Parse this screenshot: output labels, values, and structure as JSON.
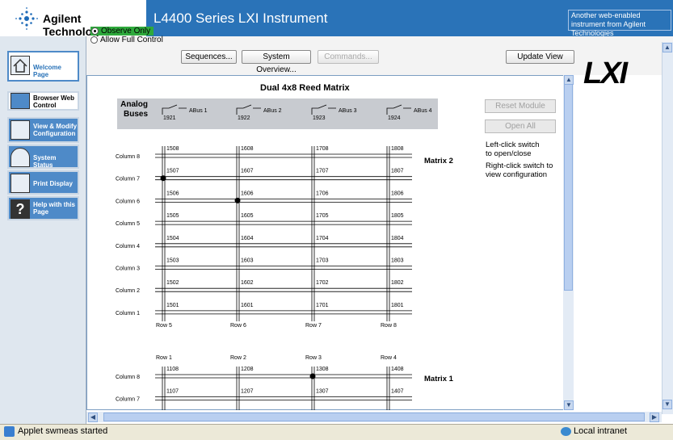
{
  "header": {
    "brand": "Agilent Technologies",
    "title": "L4400 Series LXI Instrument",
    "tagline": "Another web-enabled instrument from Agilent Technologies",
    "lxi_logo": "LXI",
    "brand_color": "#2a73b8"
  },
  "sidebar": {
    "items": [
      {
        "label": "Welcome Page",
        "icon": "home-icon",
        "active": true
      },
      {
        "label": "Browser Web Control",
        "icon": "browser-control-icon",
        "active": false
      },
      {
        "label": "View & Modify Configuration",
        "icon": "configuration-icon",
        "active": false
      },
      {
        "label": "System Status",
        "icon": "status-gauge-icon",
        "active": false
      },
      {
        "label": "Print Display",
        "icon": "printer-icon",
        "active": false
      },
      {
        "label": "Help with this Page",
        "icon": "help-icon",
        "active": false
      }
    ]
  },
  "toolbar": {
    "observe_only": "Observe Only",
    "allow_full": "Allow Full Control",
    "sequences": "Sequences...",
    "system_overview": "System Overview...",
    "commands": "Commands...",
    "update_view": "Update View"
  },
  "matrix": {
    "title": "Dual 4x8 Reed Matrix",
    "analog_buses": "Analog Buses",
    "buses": [
      {
        "name": "ABus 1",
        "num": "1921"
      },
      {
        "name": "ABus 2",
        "num": "1922"
      },
      {
        "name": "ABus 3",
        "num": "1923"
      },
      {
        "name": "ABus 4",
        "num": "1924"
      }
    ],
    "matrix2_label": "Matrix 2",
    "matrix1_label": "Matrix 1",
    "matrix2_rows": [
      "Row 5",
      "Row 6",
      "Row 7",
      "Row 8"
    ],
    "matrix1_rows": [
      "Row 1",
      "Row 2",
      "Row 3",
      "Row 4"
    ],
    "matrix2_columns": [
      {
        "label": "Column 8",
        "cells": [
          "1508",
          "1608",
          "1708",
          "1808"
        ]
      },
      {
        "label": "Column 7",
        "cells": [
          "1507",
          "1607",
          "1707",
          "1807"
        ]
      },
      {
        "label": "Column 6",
        "cells": [
          "1506",
          "1606",
          "1706",
          "1806"
        ]
      },
      {
        "label": "Column 5",
        "cells": [
          "1505",
          "1605",
          "1705",
          "1805"
        ]
      },
      {
        "label": "Column 4",
        "cells": [
          "1504",
          "1604",
          "1704",
          "1804"
        ]
      },
      {
        "label": "Column 3",
        "cells": [
          "1503",
          "1603",
          "1703",
          "1803"
        ]
      },
      {
        "label": "Column 2",
        "cells": [
          "1502",
          "1602",
          "1702",
          "1802"
        ]
      },
      {
        "label": "Column 1",
        "cells": [
          "1501",
          "1601",
          "1701",
          "1801"
        ]
      }
    ],
    "matrix1_columns": [
      {
        "label": "Column 8",
        "cells": [
          "1108",
          "1208",
          "1308",
          "1408"
        ]
      },
      {
        "label": "Column 7",
        "cells": [
          "1107",
          "1207",
          "1307",
          "1407"
        ]
      }
    ],
    "closed_channels": [
      "1507",
      "1606",
      "1308"
    ]
  },
  "side_panel": {
    "reset_module": "Reset Module",
    "open_all": "Open All",
    "help_left_1": "Left-click switch",
    "help_left_2": "to open/close",
    "help_right_1": "Right-click switch to",
    "help_right_2": "view configuration"
  },
  "statusbar": {
    "status": "Applet swmeas started",
    "zone": "Local intranet"
  }
}
